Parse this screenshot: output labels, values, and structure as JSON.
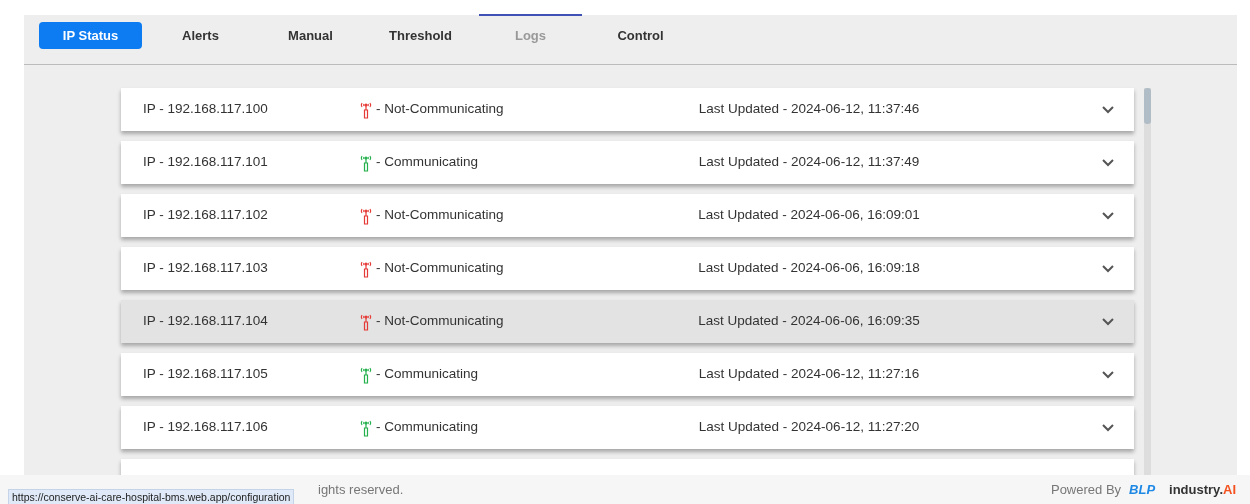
{
  "tabs": [
    {
      "label": "IP Status",
      "selected": true,
      "disabled": false,
      "highlighted": false
    },
    {
      "label": "Alerts",
      "selected": false,
      "disabled": false,
      "highlighted": false
    },
    {
      "label": "Manual",
      "selected": false,
      "disabled": false,
      "highlighted": false
    },
    {
      "label": "Threshold",
      "selected": false,
      "disabled": false,
      "highlighted": false
    },
    {
      "label": "Logs",
      "selected": false,
      "disabled": true,
      "highlighted": true
    },
    {
      "label": "Control",
      "selected": false,
      "disabled": false,
      "highlighted": false
    }
  ],
  "devices": [
    {
      "ip": "IP - 192.168.117.100",
      "communicating": false,
      "status": "- Not-Communicating",
      "updated": "Last Updated - 2024-06-12, 11:37:46",
      "hovered": false
    },
    {
      "ip": "IP - 192.168.117.101",
      "communicating": true,
      "status": "- Communicating",
      "updated": "Last Updated - 2024-06-12, 11:37:49",
      "hovered": false
    },
    {
      "ip": "IP - 192.168.117.102",
      "communicating": false,
      "status": "- Not-Communicating",
      "updated": "Last Updated - 2024-06-06, 16:09:01",
      "hovered": false
    },
    {
      "ip": "IP - 192.168.117.103",
      "communicating": false,
      "status": "- Not-Communicating",
      "updated": "Last Updated - 2024-06-06, 16:09:18",
      "hovered": false
    },
    {
      "ip": "IP - 192.168.117.104",
      "communicating": false,
      "status": "- Not-Communicating",
      "updated": "Last Updated - 2024-06-06, 16:09:35",
      "hovered": true
    },
    {
      "ip": "IP - 192.168.117.105",
      "communicating": true,
      "status": "- Communicating",
      "updated": "Last Updated - 2024-06-12, 11:27:16",
      "hovered": false
    },
    {
      "ip": "IP - 192.168.117.106",
      "communicating": true,
      "status": "- Communicating",
      "updated": "Last Updated - 2024-06-12, 11:27:20",
      "hovered": false
    }
  ],
  "footer": {
    "copyright": "ights reserved.",
    "powered_by": "Powered By",
    "partner": "BLP",
    "brand": "industry.",
    "brand_suffix": "AI"
  },
  "status_tooltip": "https://conserve-ai-care-hospital-bms.web.app/configuration"
}
